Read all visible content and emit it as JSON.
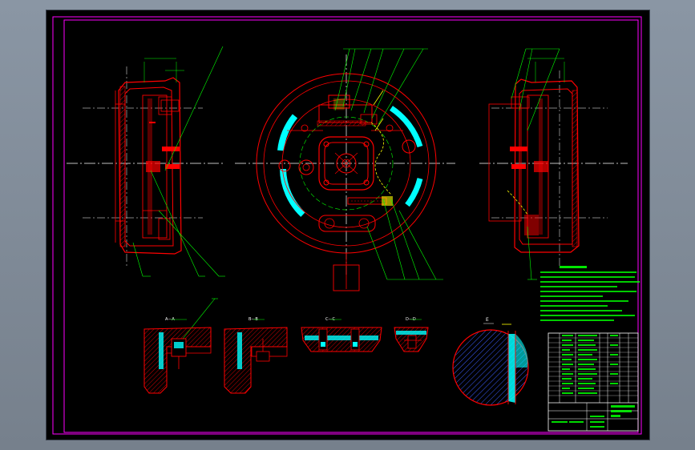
{
  "drawing": {
    "section_labels": [
      "A—A",
      "B—B",
      "C—C",
      "D—D"
    ],
    "detail_marker": "E"
  },
  "colors": {
    "background": "#000000",
    "border": "#ff00ff",
    "geometry": "#ff0000",
    "leaders": "#00ff00",
    "centerlines": "#ffffff",
    "fill_cyan": "#00ffff",
    "highlight": "#ffff00",
    "hatch": "#3a5cff"
  }
}
